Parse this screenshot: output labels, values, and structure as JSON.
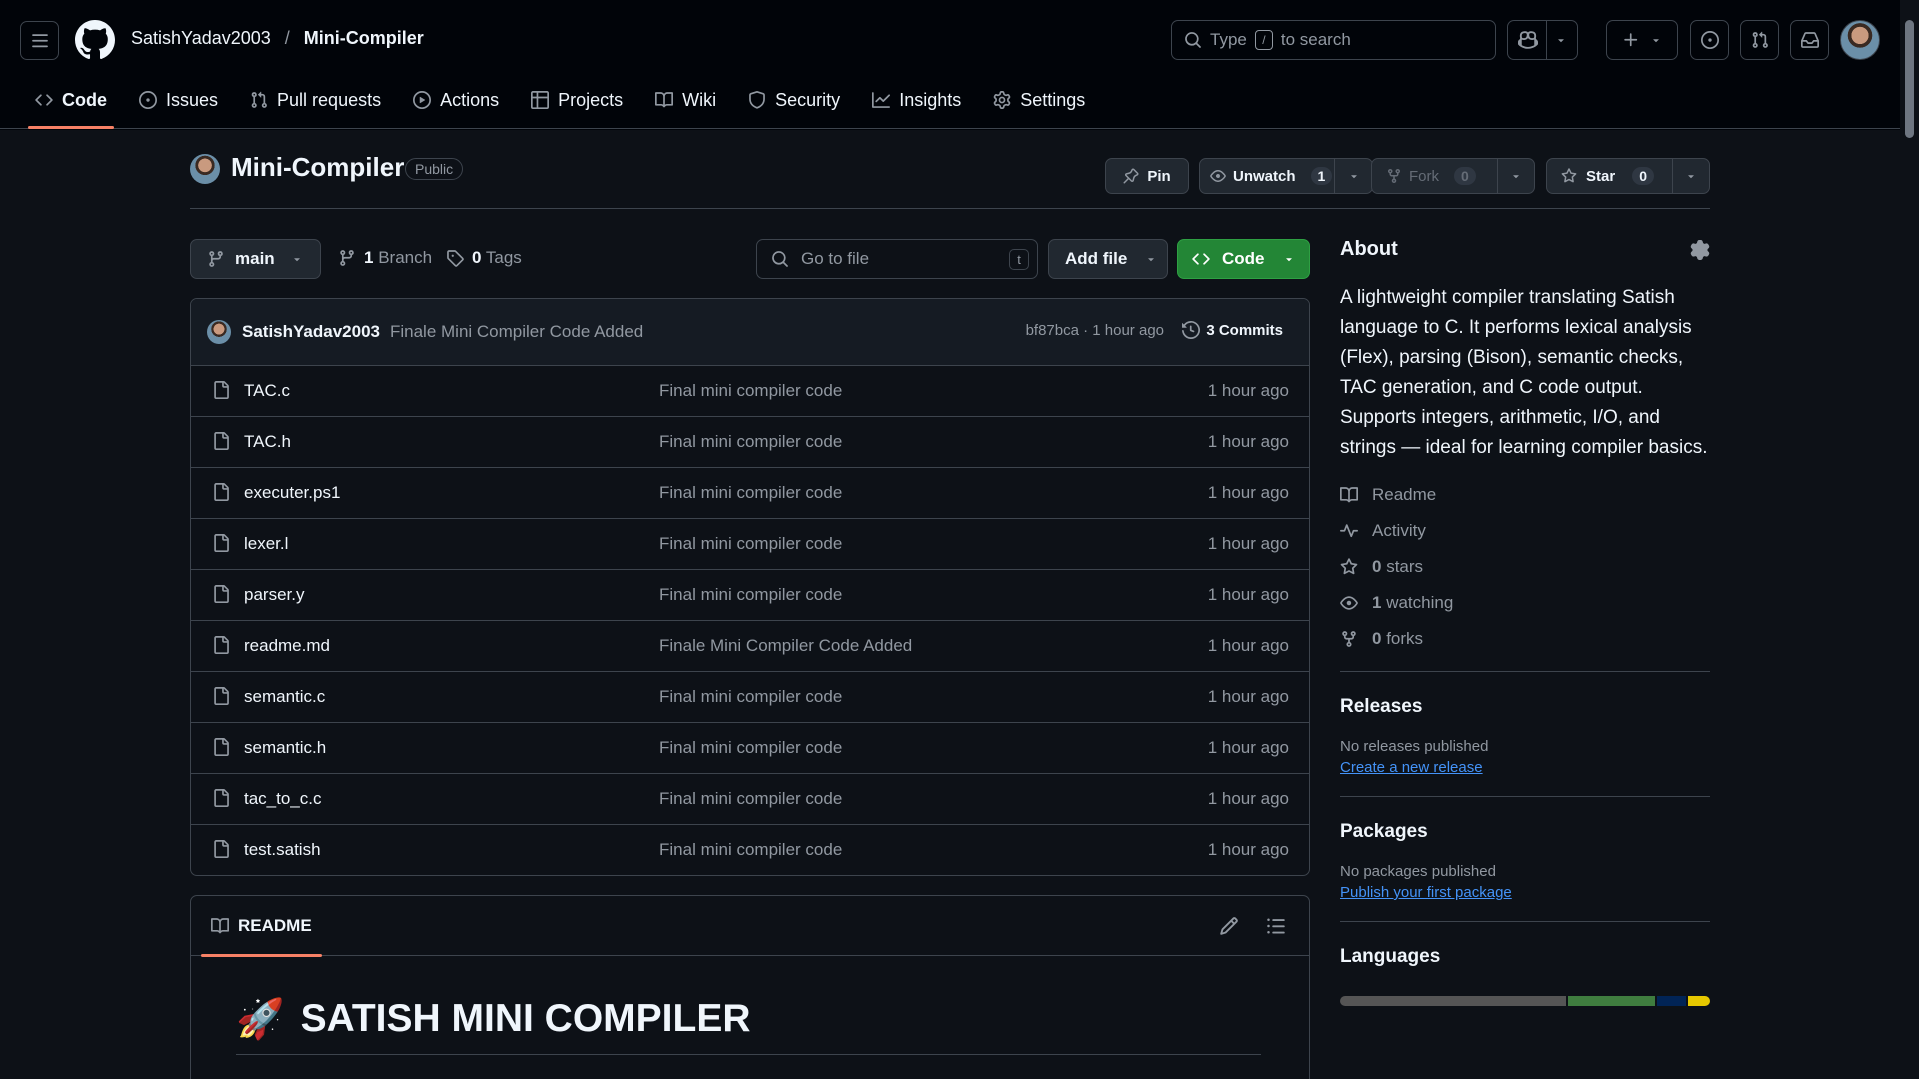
{
  "header": {
    "owner": "SatishYadav2003",
    "separator": "/",
    "repo": "Mini-Compiler",
    "search_prefix": "Type",
    "search_key": "/",
    "search_suffix": "to search"
  },
  "tabs": [
    {
      "label": "Code",
      "icon": "code-icon"
    },
    {
      "label": "Issues",
      "icon": "issue-icon"
    },
    {
      "label": "Pull requests",
      "icon": "pull-request-icon"
    },
    {
      "label": "Actions",
      "icon": "play-icon"
    },
    {
      "label": "Projects",
      "icon": "table-icon"
    },
    {
      "label": "Wiki",
      "icon": "book-icon"
    },
    {
      "label": "Security",
      "icon": "shield-icon"
    },
    {
      "label": "Insights",
      "icon": "graph-icon"
    },
    {
      "label": "Settings",
      "icon": "gear-icon"
    }
  ],
  "repo_header": {
    "name": "Mini-Compiler",
    "visibility": "Public",
    "pin_label": "Pin",
    "unwatch_label": "Unwatch",
    "watch_count": "1",
    "fork_label": "Fork",
    "fork_count": "0",
    "star_label": "Star",
    "star_count": "0"
  },
  "toolbar": {
    "branch": "main",
    "branch_count": "1",
    "branch_label": "Branch",
    "tag_count": "0",
    "tag_label": "Tags",
    "goto_placeholder": "Go to file",
    "goto_key": "t",
    "add_file_label": "Add file",
    "code_label": "Code"
  },
  "latest_commit": {
    "author": "SatishYadav2003",
    "message": "Finale Mini Compiler Code Added",
    "sha_time": "bf87bca · 1 hour ago",
    "commits_label": "3 Commits"
  },
  "files": [
    {
      "name": "TAC.c",
      "message": "Final mini compiler code",
      "time": "1 hour ago"
    },
    {
      "name": "TAC.h",
      "message": "Final mini compiler code",
      "time": "1 hour ago"
    },
    {
      "name": "executer.ps1",
      "message": "Final mini compiler code",
      "time": "1 hour ago"
    },
    {
      "name": "lexer.l",
      "message": "Final mini compiler code",
      "time": "1 hour ago"
    },
    {
      "name": "parser.y",
      "message": "Final mini compiler code",
      "time": "1 hour ago"
    },
    {
      "name": "readme.md",
      "message": "Finale Mini Compiler Code Added",
      "time": "1 hour ago"
    },
    {
      "name": "semantic.c",
      "message": "Final mini compiler code",
      "time": "1 hour ago"
    },
    {
      "name": "semantic.h",
      "message": "Final mini compiler code",
      "time": "1 hour ago"
    },
    {
      "name": "tac_to_c.c",
      "message": "Final mini compiler code",
      "time": "1 hour ago"
    },
    {
      "name": "test.satish",
      "message": "Final mini compiler code",
      "time": "1 hour ago"
    }
  ],
  "readme": {
    "tab_label": "README",
    "emoji": "🚀",
    "title": "SATISH MINI COMPILER"
  },
  "about": {
    "heading": "About",
    "description": "A lightweight compiler translating Satish language to C. It performs lexical analysis (Flex), parsing (Bison), semantic checks, TAC generation, and C code output. Supports integers, arithmetic, I/O, and strings — ideal for learning compiler basics.",
    "readme_label": "Readme",
    "activity_label": "Activity",
    "stars_count": "0",
    "stars_label": "stars",
    "watching_count": "1",
    "watching_label": "watching",
    "forks_count": "0",
    "forks_label": "forks"
  },
  "releases": {
    "heading": "Releases",
    "empty": "No releases published",
    "link": "Create a new release"
  },
  "packages": {
    "heading": "Packages",
    "empty": "No packages published",
    "link": "Publish your first package"
  },
  "languages": {
    "heading": "Languages",
    "bar": [
      {
        "share": 0.62,
        "color": "#555555"
      },
      {
        "share": 0.24,
        "color": "#3f7d3f"
      },
      {
        "share": 0.08,
        "color": "#012456"
      },
      {
        "share": 0.06,
        "color": "#e6c800"
      }
    ]
  },
  "colors": {
    "accent": "#f78166",
    "primary_button": "#238636",
    "link": "#4493f8"
  }
}
